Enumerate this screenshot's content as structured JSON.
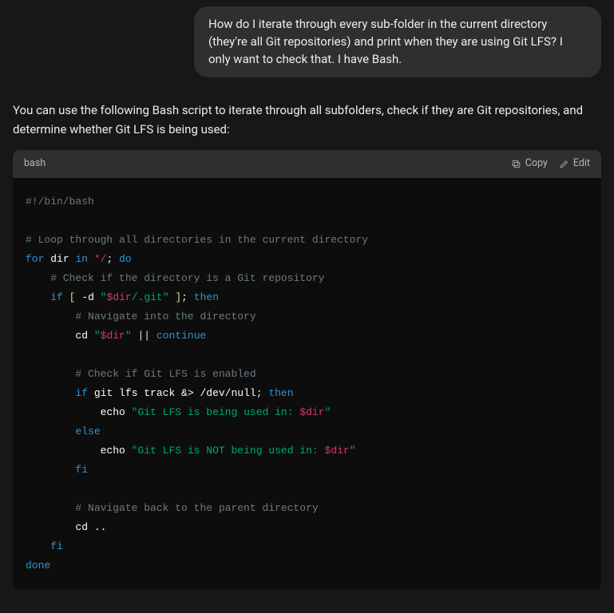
{
  "user_message": "How do I iterate through every sub-folder in the current directory (they're all Git repositories) and print when they are using Git LFS? I only want to check that. I have Bash.",
  "assistant_intro": "You can use the following Bash script to iterate through all subfolders, check if they are Git repositories, and determine whether Git LFS is being used:",
  "code_header": {
    "lang": "bash",
    "copy_label": "Copy",
    "edit_label": "Edit"
  },
  "code": {
    "shebang": "#!/bin/bash",
    "c_loop": "# Loop through all directories in the current directory",
    "for": "for",
    "dir": "dir",
    "in": "in",
    "glob": "*/",
    "sc": ";",
    "do": "do",
    "c_check_repo": "# Check if the directory is a Git repository",
    "if": "if",
    "lb": "[",
    "flag_d": "-d",
    "q": "\"",
    "var_dir": "$dir",
    "git_suffix": "/.git",
    "rb": "]",
    "then": "then",
    "c_nav_in": "# Navigate into the directory",
    "cd": "cd",
    "or": "||",
    "continue": "continue",
    "c_check_lfs": "# Check if Git LFS is enabled",
    "gitlfs": "git lfs track &> /dev/null",
    "echo": "echo",
    "msg_yes_pre": "Git LFS is being used in: ",
    "else": "else",
    "msg_no_pre": "Git LFS is NOT being used in: ",
    "fi": "fi",
    "c_nav_back": "# Navigate back to the parent directory",
    "cd_back": "..",
    "done": "done"
  }
}
